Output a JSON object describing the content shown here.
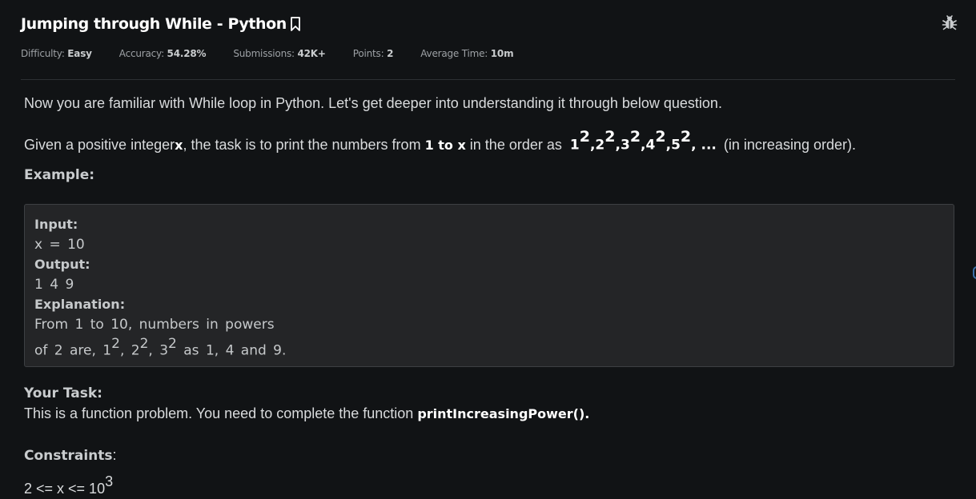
{
  "header": {
    "title": "Jumping through While - Python",
    "bookmark_icon": "bookmark-icon",
    "bug_icon": "bug-icon",
    "meta": [
      {
        "label": "Difficulty: ",
        "value": "Easy"
      },
      {
        "label": "Accuracy: ",
        "value": "54.28%"
      },
      {
        "label": "Submissions: ",
        "value": "42K+"
      },
      {
        "label": "Points: ",
        "value": "2"
      },
      {
        "label": "Average Time: ",
        "value": "10m"
      }
    ]
  },
  "problem": {
    "intro": "Now you are familiar with While loop in Python. Let's get deeper into understanding it through below question.",
    "given_prefix": "Given a positive integer ",
    "given_var": "x",
    "given_mid": ", the task is to print the numbers from ",
    "given_range": "1 to x",
    "given_mid2": " in the order as ",
    "powers": [
      "1",
      "2",
      "3",
      "4",
      "5"
    ],
    "power_exp": "2",
    "powers_tail": ", ...",
    "given_suffix": " (in increasing order).",
    "example_heading": "Example:"
  },
  "example": {
    "input_label": "Input:",
    "input_value": "x = 10",
    "output_label": "Output:",
    "output_value": "1 4 9",
    "explanation_label": "Explanation:",
    "explanation_line1": "From 1 to 10, numbers in powers",
    "explanation_line2_a": "of 2 are, 1",
    "explanation_line2_b": ", 2",
    "explanation_line2_c": ", 3",
    "explanation_line2_d": " as 1, 4 and 9.",
    "exp": "2"
  },
  "task": {
    "heading": "Your Task:",
    "text": "This is a function problem. You need to complete the function ",
    "function_name": "printIncreasingPower()."
  },
  "constraints": {
    "heading": "Constraints",
    "colon": ":",
    "value": "2 <= x <= 10",
    "exp": "3"
  }
}
